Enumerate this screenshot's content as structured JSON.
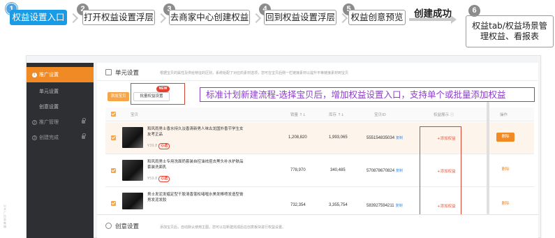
{
  "flow": {
    "steps": [
      {
        "num": "1",
        "label": "权益设置入口"
      },
      {
        "num": "2",
        "label": "打开权益设置浮层"
      },
      {
        "num": "3",
        "label": "去商家中心创建权益"
      },
      {
        "num": "4",
        "label": "回到权益设置浮层"
      },
      {
        "num": "5",
        "label": "权益创意预览"
      }
    ],
    "success_label": "创建成功",
    "final_step": {
      "num": "6",
      "line1": "权益tab/权益场景管",
      "line2": "理权益、看报表"
    }
  },
  "sidebar": {
    "items": [
      {
        "label": "推广设置",
        "num": "1"
      },
      {
        "label": "单元设置"
      },
      {
        "label": "创意设置"
      },
      {
        "label": "推广管理",
        "num": "2"
      },
      {
        "label": "创建完成",
        "num": "3"
      }
    ]
  },
  "unit_section": {
    "title": "单元设置",
    "hint": "根据宝贝的属性及供给特征的区别，系统给配了对应的素材选项，您可在宝贝后侧一栏链接素材以提升平等链接素材到宝贝",
    "add_button": "添加宝贝",
    "batch_button": "批量权益设置",
    "new_badge": "NEW"
  },
  "annotation": "标准计划新建流程-选择宝贝后，增加权益设置入口，支持单个或批量添加权益",
  "table": {
    "headers": {
      "product": "宝贝",
      "sales": "销量 ↑↓",
      "stock": "库存 ↑↓",
      "id": "宝贝ID",
      "rights": "权益展示 ⓘ",
      "action": "操作"
    },
    "rows": [
      {
        "title": "和风雨男士香水持久淡香清新男人味古龙国外香节学生女友考正品",
        "price": "¥39.8",
        "tag": "心选",
        "sales": "1,208,820",
        "stock": "1,993,065",
        "item_id": "555154835034",
        "copy": "复制",
        "add": "+添加权益",
        "delete": "删除"
      },
      {
        "title": "和风雨男士专用洗面奶套装自控油祛痘去黑头补水护肤品套装洗面乳",
        "price": "¥59.8",
        "tag": "心选",
        "sales": "778,970",
        "stock": "340,485",
        "item_id": "570878670824",
        "copy": "复制",
        "add": "+添加权益",
        "delete": "删除"
      },
      {
        "title": "男士发泥发蜡定型干胶清香蓬松啫喱水美发棒喷发造型膏男发泥发胶",
        "price": "¥49.8",
        "tag": "",
        "sales": "732,354",
        "stock": "3,355,754",
        "item_id": "583927594211",
        "copy": "复制",
        "add": "+添加权益",
        "delete": "删除"
      }
    ]
  },
  "creative_section": {
    "title": "创意设置",
    "hint": "添加宝贝后，自动默认使用主图，您可以在新建完成后在创意板块进行权益设置。"
  },
  "side_note": "以 关 广 告 收 集 编"
}
